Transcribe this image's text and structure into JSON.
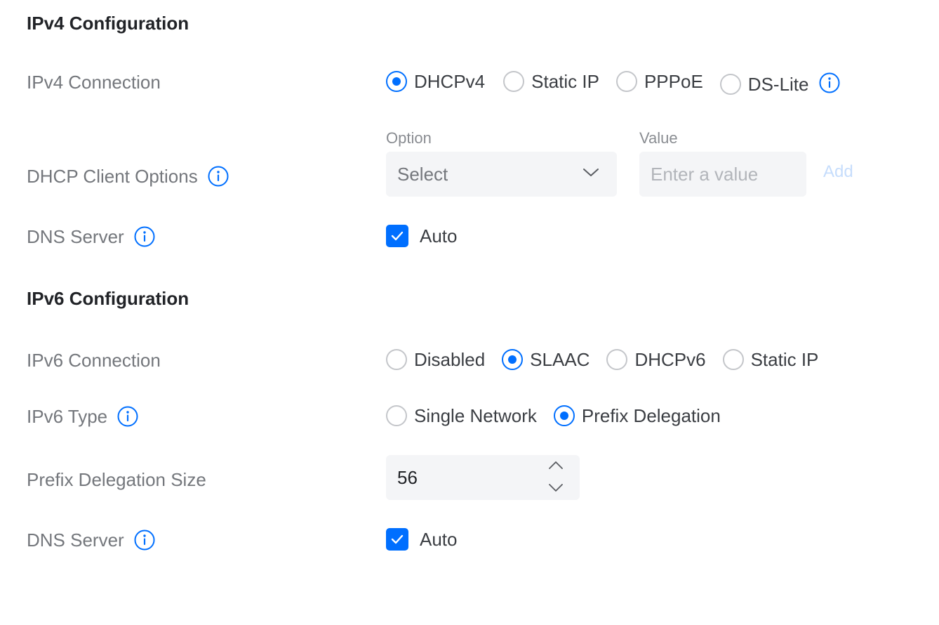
{
  "colors": {
    "accent": "#006fff",
    "label": "#74777c",
    "heading": "#212327"
  },
  "ipv4": {
    "title": "IPv4 Configuration",
    "connection": {
      "label": "IPv4 Connection",
      "options": [
        "DHCPv4",
        "Static IP",
        "PPPoE",
        "DS-Lite"
      ],
      "selected": "DHCPv4"
    },
    "dhcp_client_options": {
      "label": "DHCP Client Options",
      "option_label": "Option",
      "value_label": "Value",
      "select_text": "Select",
      "value_placeholder": "Enter a value",
      "add_label": "Add"
    },
    "dns": {
      "label": "DNS Server",
      "auto_label": "Auto",
      "auto_checked": true
    }
  },
  "ipv6": {
    "title": "IPv6 Configuration",
    "connection": {
      "label": "IPv6 Connection",
      "options": [
        "Disabled",
        "SLAAC",
        "DHCPv6",
        "Static IP"
      ],
      "selected": "SLAAC"
    },
    "type": {
      "label": "IPv6 Type",
      "options": [
        "Single Network",
        "Prefix Delegation"
      ],
      "selected": "Prefix Delegation"
    },
    "prefix_size": {
      "label": "Prefix Delegation Size",
      "value": "56"
    },
    "dns": {
      "label": "DNS Server",
      "auto_label": "Auto",
      "auto_checked": true
    }
  }
}
